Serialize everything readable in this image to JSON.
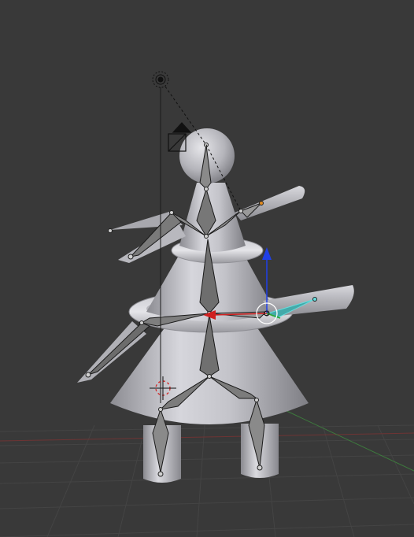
{
  "viewport": {
    "mode": "pose",
    "background_color": "#393939",
    "grid_color": "#444444",
    "x_axis_color": "#8b3a3a",
    "y_axis_color": "#3d7a3d"
  },
  "scene": {
    "mesh": {
      "name": "snowman-tree",
      "material_color": "#c8c8cc",
      "parts": [
        "head-sphere",
        "upper-cone",
        "upper-ring",
        "lower-cone",
        "lower-ring",
        "bottom-cone",
        "left-leg-cylinder",
        "right-leg-cylinder",
        "left-arm-horn",
        "right-arm-horn"
      ]
    },
    "armature": {
      "bone_color": "#8a8a8a",
      "selected_bone_color": "#54c4c4",
      "bones": [
        "head",
        "spine-upper",
        "spine-lower",
        "upper-left-arm",
        "upper-right-arm",
        "lower-left-arm",
        "lower-right-arm",
        "left-thigh",
        "right-thigh",
        "left-shin",
        "right-shin"
      ]
    },
    "objects": [
      "lamp",
      "camera",
      "3d-cursor"
    ],
    "manipulator": {
      "axes": [
        "x",
        "z",
        "view"
      ],
      "x_color": "#d02020",
      "z_color": "#2040e8",
      "view_color": "#ffffff"
    }
  }
}
